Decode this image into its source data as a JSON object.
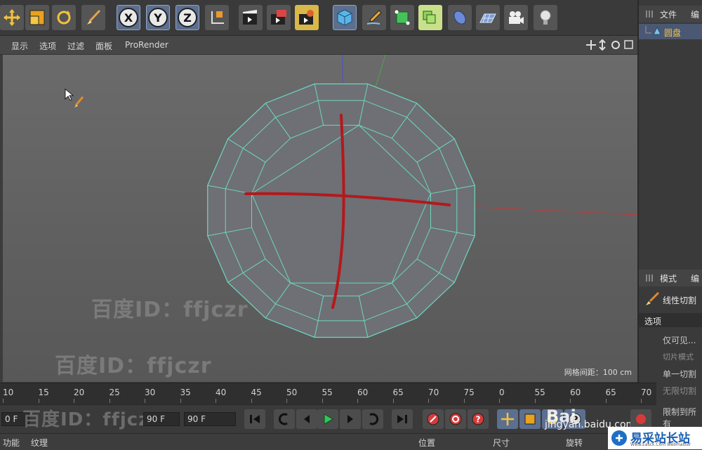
{
  "menu": {
    "items": [
      "显示",
      "选项",
      "过滤",
      "面板",
      "ProRender"
    ]
  },
  "toolbar": {
    "axes": [
      "X",
      "Y",
      "Z"
    ],
    "icons": [
      "move-icon",
      "scale-icon",
      "rotate-icon",
      "brush-icon",
      "x-axis-icon",
      "y-axis-icon",
      "z-axis-icon",
      "coordinate-system-icon",
      "render-view-icon",
      "render-picture-viewer-icon",
      "render-settings-icon",
      "cube-icon",
      "pen-icon",
      "subdivision-icon",
      "array-icon",
      "deformer-icon",
      "floor-icon",
      "camera-icon",
      "light-icon"
    ]
  },
  "viewport": {
    "grid_spacing": "网格间距：100 cm",
    "watermarks": [
      "百度ID：ffjczr",
      "百度ID：ffjczr",
      "百度ID：ffjczr"
    ]
  },
  "object_manager": {
    "tab": "文件",
    "tab2": "编",
    "object_name": "圆盘"
  },
  "attributes": {
    "tab": "模式",
    "tab2": "编",
    "tool_name": "线性切割",
    "section": "选项",
    "options": [
      "仅可见...",
      "切片模式",
      "单一切割",
      "无限切割",
      "限制到所有"
    ]
  },
  "timeline": {
    "ticks": [
      "10",
      "15",
      "20",
      "25",
      "30",
      "35",
      "40",
      "45",
      "50",
      "55",
      "60",
      "65",
      "70",
      "75",
      "0",
      "55",
      "60",
      "65",
      "70"
    ]
  },
  "transport": {
    "start_field": "0 F",
    "end_field": "90 F",
    "end_field2": "90 F"
  },
  "bottombar": {
    "items": [
      "功能",
      "纹理",
      "位置",
      "尺寸",
      "旋转"
    ]
  },
  "brand": {
    "site": "jingyan.baidu.com",
    "logo_text": "易采站长站",
    "logo_sub": "Www.Easck.Com Webmaster",
    "partial_logo": "Bai"
  },
  "colors": {
    "mesh": "#6ed6c0",
    "stroke": "#b3191c",
    "x_axis": "#c23a3a",
    "y_axis": "#4ea34e",
    "z_axis": "#4850c8"
  }
}
